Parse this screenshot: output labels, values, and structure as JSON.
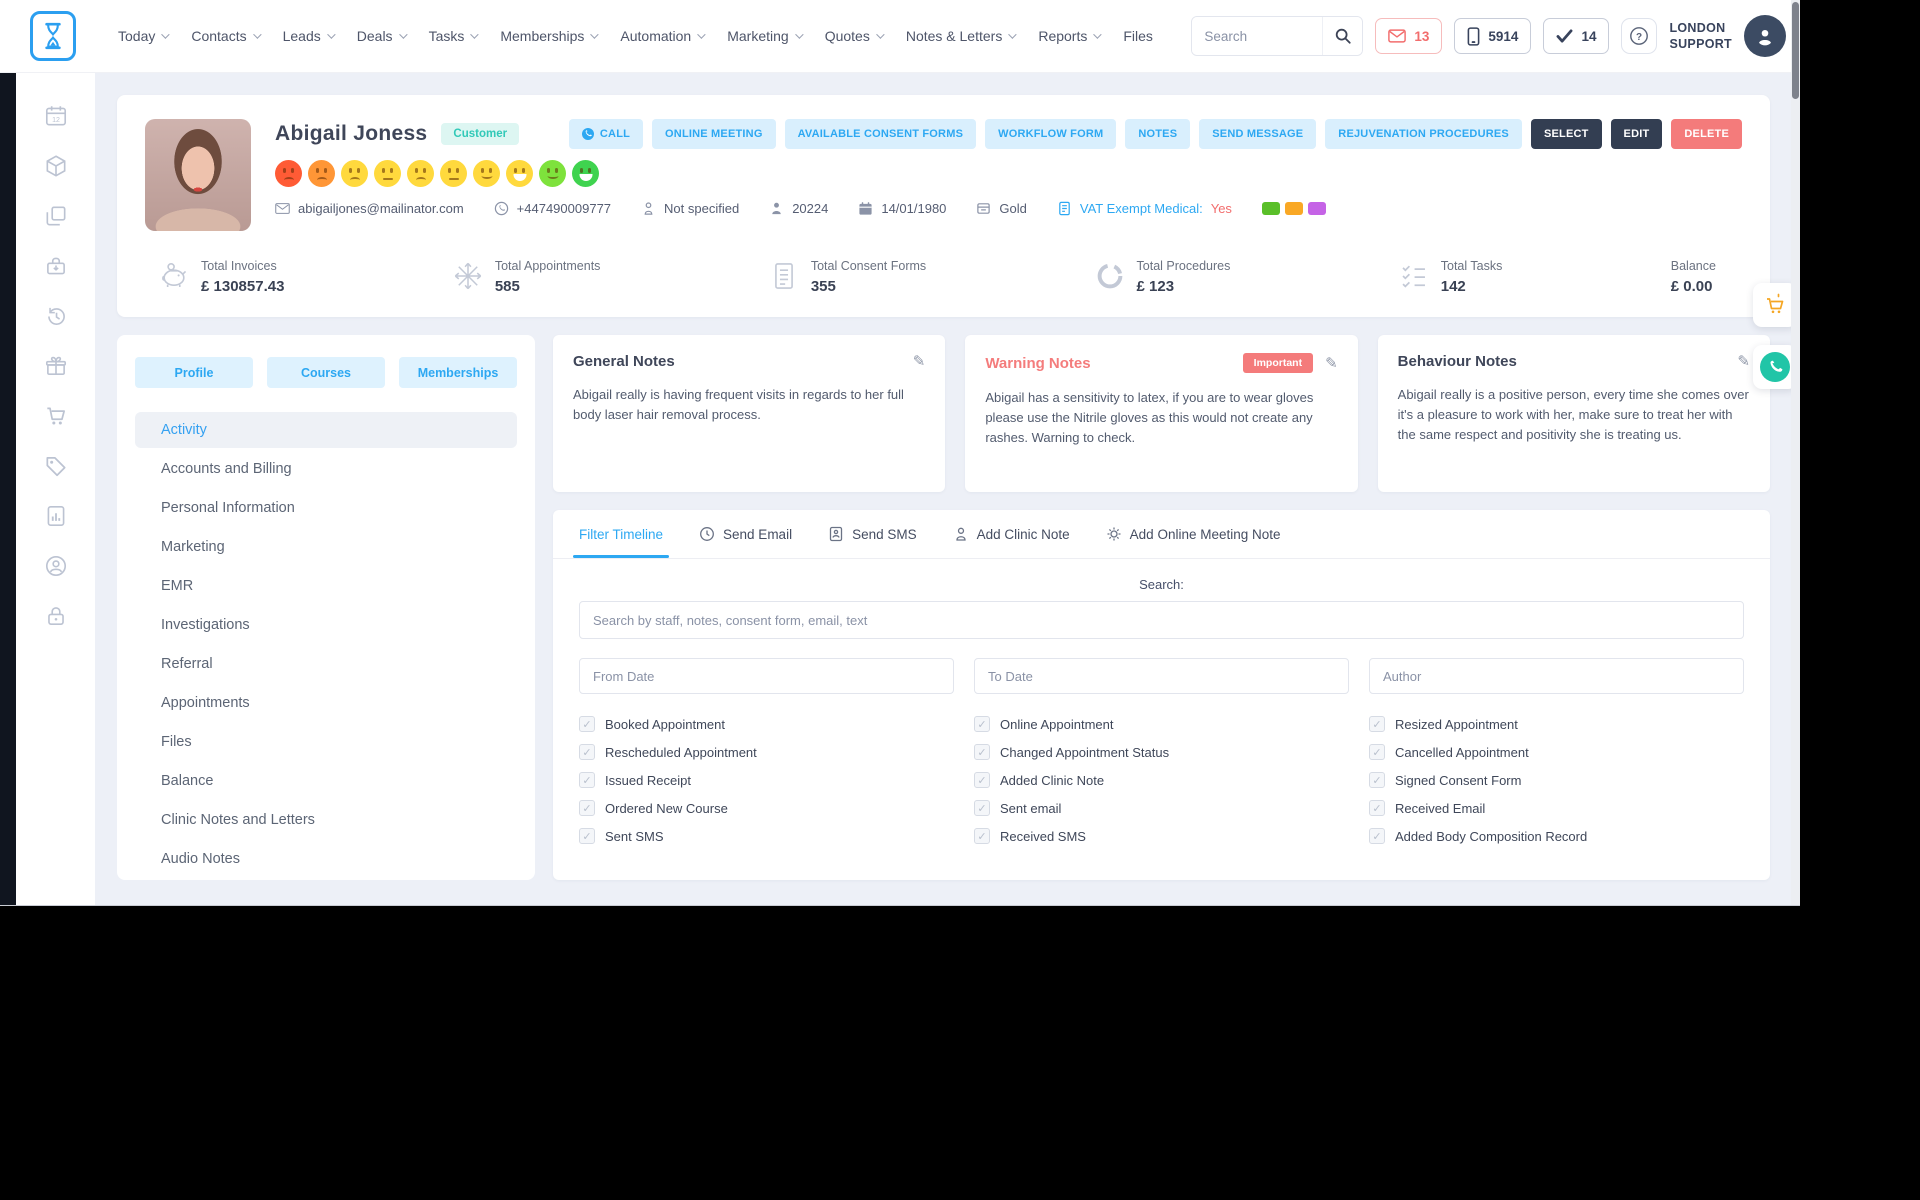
{
  "topnav": {
    "items": [
      {
        "label": "Today",
        "chevron": true
      },
      {
        "label": "Contacts",
        "chevron": true
      },
      {
        "label": "Leads",
        "chevron": true
      },
      {
        "label": "Deals",
        "chevron": true
      },
      {
        "label": "Tasks",
        "chevron": true
      },
      {
        "label": "Memberships",
        "chevron": true
      },
      {
        "label": "Automation",
        "chevron": true
      },
      {
        "label": "Marketing",
        "chevron": true
      },
      {
        "label": "Quotes",
        "chevron": true
      },
      {
        "label": "Notes & Letters",
        "chevron": true
      },
      {
        "label": "Reports",
        "chevron": true
      },
      {
        "label": "Files",
        "chevron": false
      }
    ],
    "search_placeholder": "Search",
    "mail_count": "13",
    "phone_count": "5914",
    "tasks_count": "14",
    "help_label": "?",
    "account_line1": "LONDON",
    "account_line2": "SUPPORT"
  },
  "side_rail": {
    "icons": [
      "calendar",
      "package",
      "copy",
      "till",
      "history",
      "gift",
      "cart",
      "tag",
      "report",
      "client-circle",
      "lock"
    ]
  },
  "profile": {
    "name": "Abigail Joness",
    "tag": "Customer",
    "email": "abigailjones@mailinator.com",
    "phone": "+447490009777",
    "gender": "Not specified",
    "client_id": "20224",
    "dob": "14/01/1980",
    "tier": "Gold",
    "vat_label": "VAT Exempt Medical:",
    "vat_value": "Yes",
    "label_colors": [
      "#5abf29",
      "#f9a825",
      "#c563e6"
    ],
    "mood_scale": [
      {
        "color": "#ff5b35",
        "mouth": "frown"
      },
      {
        "color": "#ff9636",
        "mouth": "frown"
      },
      {
        "color": "#ffd93d",
        "mouth": "frown"
      },
      {
        "color": "#ffd93d",
        "mouth": "flat"
      },
      {
        "color": "#ffd93d",
        "mouth": "frown"
      },
      {
        "color": "#ffd93d",
        "mouth": "flat"
      },
      {
        "color": "#ffd93d",
        "mouth": "smile"
      },
      {
        "color": "#ffd93d",
        "mouth": "grin"
      },
      {
        "color": "#7ee23c",
        "mouth": "smile"
      },
      {
        "color": "#3fd34f",
        "mouth": "grin"
      }
    ]
  },
  "actions": {
    "call": "CALL",
    "online_meeting": "ONLINE MEETING",
    "consent_forms": "AVAILABLE CONSENT FORMS",
    "workflow_form": "WORKFLOW FORM",
    "notes": "NOTES",
    "send_message": "SEND MESSAGE",
    "rejuvenation": "REJUVENATION PROCEDURES",
    "select": "SELECT",
    "edit": "EDIT",
    "delete": "DELETE"
  },
  "stats": [
    {
      "label": "Total Invoices",
      "value": "£ 130857.43",
      "icon": "piggy-bank"
    },
    {
      "label": "Total Appointments",
      "value": "585",
      "icon": "snowflake"
    },
    {
      "label": "Total Consent Forms",
      "value": "355",
      "icon": "document"
    },
    {
      "label": "Total Procedures",
      "value": "£ 123",
      "icon": "donut-chart"
    },
    {
      "label": "Total Tasks",
      "value": "142",
      "icon": "checklist"
    },
    {
      "label": "Balance",
      "value": "£ 0.00",
      "icon": ""
    }
  ],
  "left_panel": {
    "tabs": [
      {
        "label": "Profile"
      },
      {
        "label": "Courses"
      },
      {
        "label": "Memberships"
      }
    ],
    "menu": [
      {
        "label": "Activity",
        "active": true
      },
      {
        "label": "Accounts and Billing"
      },
      {
        "label": "Personal Information"
      },
      {
        "label": "Marketing"
      },
      {
        "label": "EMR"
      },
      {
        "label": "Investigations"
      },
      {
        "label": "Referral"
      },
      {
        "label": "Appointments"
      },
      {
        "label": "Files"
      },
      {
        "label": "Balance"
      },
      {
        "label": "Clinic Notes and Letters"
      },
      {
        "label": "Audio Notes"
      }
    ]
  },
  "notes": {
    "general": {
      "title": "General Notes",
      "body": "Abigail really is having frequent visits in regards to her full body laser hair removal process."
    },
    "warning": {
      "title": "Warning Notes",
      "badge": "Important",
      "body": "Abigail has a sensitivity to latex, if you are to wear gloves please use the Nitrile gloves as this would not create any rashes. Warning to check."
    },
    "behaviour": {
      "title": "Behaviour Notes",
      "body": "Abigail really is a positive person, every time she comes over it's a pleasure to work with her, make sure to treat her with the same respect and positivity she is treating us."
    }
  },
  "timeline": {
    "tabs": [
      {
        "label": "Filter Timeline",
        "active": true
      },
      {
        "label": "Send Email",
        "icon": "clock"
      },
      {
        "label": "Send SMS",
        "icon": "sms"
      },
      {
        "label": "Add Clinic Note",
        "icon": "person"
      },
      {
        "label": "Add Online Meeting Note",
        "icon": "gear"
      }
    ],
    "search_label": "Search:",
    "search_placeholder": "Search by staff, notes, consent form, email, text",
    "inputs": [
      "From Date",
      "To Date",
      "Author"
    ],
    "filters": [
      [
        "Booked Appointment",
        "Rescheduled Appointment",
        "Issued Receipt",
        "Ordered New Course",
        "Sent SMS"
      ],
      [
        "Online Appointment",
        "Changed Appointment Status",
        "Added Clinic Note",
        "Sent email",
        "Received SMS"
      ],
      [
        "Resized Appointment",
        "Cancelled Appointment",
        "Signed Consent Form",
        "Received Email",
        "Added Body Composition Record"
      ]
    ]
  },
  "floating": {
    "icons": [
      "cart",
      "whatsapp"
    ]
  }
}
